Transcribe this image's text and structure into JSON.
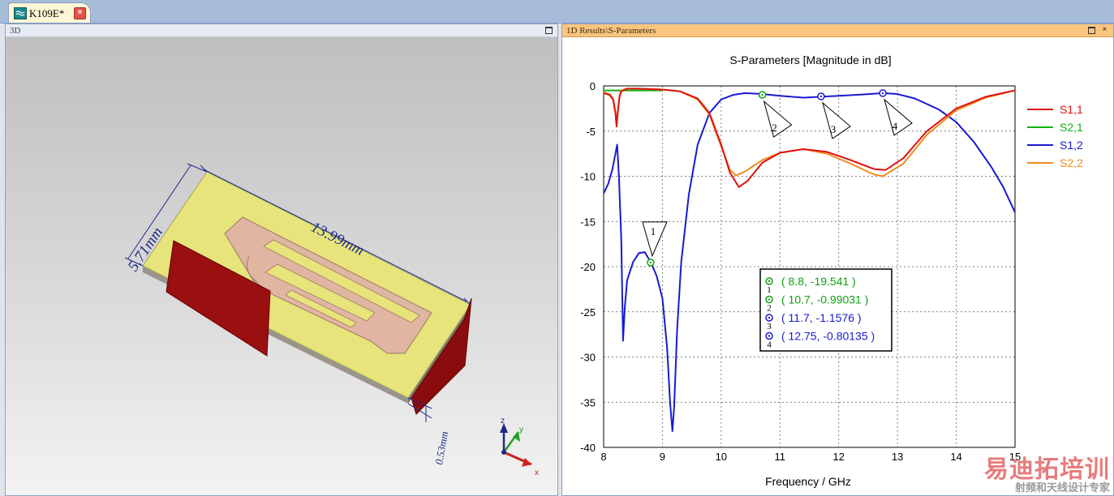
{
  "document_tab": {
    "label": "K109E*",
    "close_glyph": "×"
  },
  "panel_3d": {
    "title": "3D",
    "dimensions": {
      "length": "13.99mm",
      "width": "5.71mm",
      "thickness": "0.53mm"
    },
    "axes": {
      "x": "x",
      "y": "y",
      "z": "z"
    }
  },
  "panel_1d": {
    "title": "1D Results\\S-Parameters"
  },
  "titlebar_buttons": {
    "close": "×"
  },
  "chart_data": {
    "type": "line",
    "title": "S-Parameters [Magnitude in dB]",
    "xlabel": "Frequency / GHz",
    "ylabel": "",
    "xlim": [
      8,
      15
    ],
    "ylim": [
      -40,
      0
    ],
    "x_ticks": [
      "8",
      "9",
      "10",
      "11",
      "12",
      "13",
      "14",
      "15"
    ],
    "y_ticks": [
      "0",
      "-5",
      "-10",
      "-15",
      "-20",
      "-25",
      "-30",
      "-35",
      "-40"
    ],
    "grid": "dotted",
    "legend_position": "right",
    "series": [
      {
        "name": "S1,1",
        "color": "#e01010",
        "x": [
          8.0,
          8.1,
          8.16,
          8.2,
          8.22,
          8.24,
          8.27,
          8.3,
          8.4,
          8.6,
          9.0,
          9.3,
          9.6,
          9.8,
          10.0,
          10.15,
          10.3,
          10.45,
          10.7,
          11.0,
          11.4,
          11.8,
          12.2,
          12.6,
          12.8,
          13.1,
          13.5,
          14.0,
          14.5,
          15.0
        ],
        "y": [
          -0.8,
          -1.0,
          -1.5,
          -3.0,
          -4.5,
          -3.0,
          -1.2,
          -0.6,
          -0.3,
          -0.3,
          -0.4,
          -0.6,
          -1.4,
          -3.0,
          -6.5,
          -9.6,
          -11.2,
          -10.5,
          -8.5,
          -7.4,
          -7.0,
          -7.3,
          -8.2,
          -9.2,
          -9.3,
          -8.0,
          -5.0,
          -2.5,
          -1.2,
          -0.5
        ]
      },
      {
        "name": "S2,1",
        "color": "#10b010",
        "x": [
          8.0,
          8.2,
          8.4,
          8.6,
          8.8,
          9.0
        ],
        "y": [
          -0.5,
          -0.5,
          -0.5,
          -0.5,
          -0.5,
          -0.5
        ]
      },
      {
        "name": "S1,2",
        "color": "#1a1ad0",
        "x": [
          8.0,
          8.08,
          8.15,
          8.2,
          8.23,
          8.26,
          8.3,
          8.33,
          8.36,
          8.4,
          8.5,
          8.6,
          8.7,
          8.8,
          8.9,
          9.0,
          9.08,
          9.13,
          9.17,
          9.2,
          9.25,
          9.32,
          9.45,
          9.6,
          9.8,
          10.0,
          10.2,
          10.4,
          10.7,
          11.0,
          11.4,
          11.7,
          12.0,
          12.4,
          12.75,
          13.0,
          13.3,
          13.7,
          14.0,
          14.3,
          14.6,
          14.8,
          15.0
        ],
        "y": [
          -11.9,
          -10.8,
          -9.2,
          -7.5,
          -6.5,
          -10.0,
          -17.0,
          -28.2,
          -24.5,
          -21.5,
          -19.5,
          -18.5,
          -18.4,
          -19.5,
          -21.0,
          -23.5,
          -29.0,
          -35.0,
          -38.2,
          -35.5,
          -27.0,
          -19.5,
          -12.0,
          -6.5,
          -3.0,
          -1.5,
          -1.0,
          -0.8,
          -0.9,
          -1.1,
          -1.3,
          -1.2,
          -1.1,
          -0.95,
          -0.8,
          -0.9,
          -1.4,
          -2.6,
          -4.0,
          -6.2,
          -9.0,
          -11.2,
          -14.0
        ]
      },
      {
        "name": "S2,2",
        "color": "#f08c1e",
        "x": [
          8.0,
          8.1,
          8.16,
          8.2,
          8.22,
          8.24,
          8.27,
          8.3,
          8.4,
          8.6,
          9.0,
          9.3,
          9.6,
          9.8,
          10.0,
          10.15,
          10.25,
          10.4,
          10.7,
          11.0,
          11.4,
          11.8,
          12.2,
          12.6,
          12.75,
          13.1,
          13.5,
          14.0,
          14.5,
          15.0
        ],
        "y": [
          -0.7,
          -0.9,
          -1.4,
          -2.8,
          -4.2,
          -2.8,
          -1.1,
          -0.5,
          -0.3,
          -0.3,
          -0.4,
          -0.6,
          -1.5,
          -3.2,
          -6.7,
          -9.3,
          -9.9,
          -9.5,
          -8.2,
          -7.4,
          -7.0,
          -7.5,
          -8.6,
          -9.8,
          -10.0,
          -8.6,
          -5.4,
          -2.7,
          -1.3,
          -0.5
        ]
      }
    ],
    "markers": [
      {
        "id": "1",
        "x": 8.8,
        "y": -19.541,
        "label": "( 8.8, -19.541 )",
        "color": "#10a010"
      },
      {
        "id": "2",
        "x": 10.7,
        "y": -0.99031,
        "label": "( 10.7, -0.99031 )",
        "color": "#10a010"
      },
      {
        "id": "3",
        "x": 11.7,
        "y": -1.1576,
        "label": "( 11.7, -1.1576 )",
        "color": "#1a1ad0"
      },
      {
        "id": "4",
        "x": 12.75,
        "y": -0.80135,
        "label": "( 12.75, -0.80135 )",
        "color": "#1a1ad0"
      }
    ]
  },
  "watermark": {
    "main": "易迪拓培训",
    "sub": "射频和天线设计专家"
  }
}
